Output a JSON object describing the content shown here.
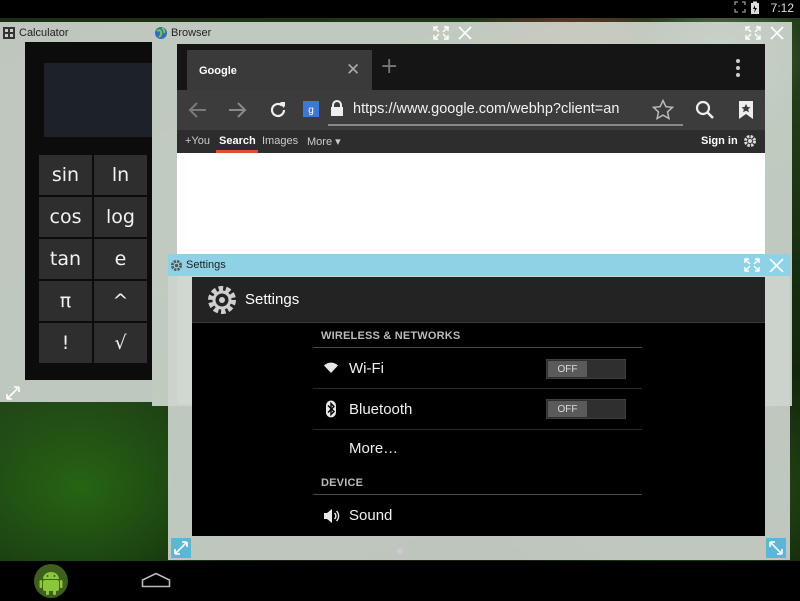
{
  "status_bar": {
    "time": "7:12"
  },
  "calculator": {
    "title": "Calculator",
    "keys": [
      "sin",
      "ln",
      "cos",
      "log",
      "tan",
      "e",
      "π",
      "^",
      "!",
      "√"
    ]
  },
  "browser": {
    "title": "Browser",
    "tab": {
      "label": "Google"
    },
    "url": "https://www.google.com/webhp?client=an",
    "google_bar": {
      "you": "+You",
      "search": "Search",
      "images": "Images",
      "more": "More",
      "sign_in": "Sign in"
    }
  },
  "settings": {
    "title": "Settings",
    "header": "Settings",
    "sections": [
      {
        "label": "WIRELESS & NETWORKS"
      },
      {
        "label": "DEVICE"
      }
    ],
    "items": {
      "wifi": {
        "label": "Wi-Fi",
        "toggle": "OFF"
      },
      "bluetooth": {
        "label": "Bluetooth",
        "toggle": "OFF"
      },
      "more": {
        "label": "More…"
      },
      "sound": {
        "label": "Sound"
      }
    }
  },
  "colors": {
    "settings_titlebar": "#8fd2e6",
    "google_tab_underline": "#dd4b39",
    "android_green": "#8cc63f"
  },
  "icons": [
    "battery-icon",
    "globe-icon",
    "calculator-icon",
    "gear-icon",
    "wifi-icon",
    "bluetooth-icon",
    "speaker-icon",
    "maximize-icon",
    "close-icon",
    "android-icon",
    "home-icon"
  ]
}
